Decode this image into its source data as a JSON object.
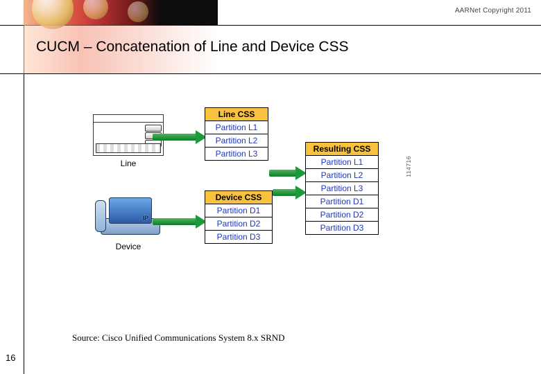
{
  "header": {
    "copyright": "AARNet Copyright 2011"
  },
  "title": "CUCM – Concatenation of Line and Device CSS",
  "page_number": "16",
  "source_text": "Source:  Cisco Unified Communications System 8.x SRND",
  "diagram": {
    "line_label": "Line",
    "device_label": "Device",
    "line_css": {
      "header": "Line CSS",
      "rows": [
        "Partition L1",
        "Partition L2",
        "Partition L3"
      ]
    },
    "device_css": {
      "header": "Device CSS",
      "rows": [
        "Partition D1",
        "Partition D2",
        "Partition D3"
      ]
    },
    "resulting_css": {
      "header": "Resulting CSS",
      "rows": [
        "Partition L1",
        "Partition L2",
        "Partition L3",
        "Partition D1",
        "Partition D2",
        "Partition D3"
      ]
    },
    "figure_number": "114716"
  }
}
